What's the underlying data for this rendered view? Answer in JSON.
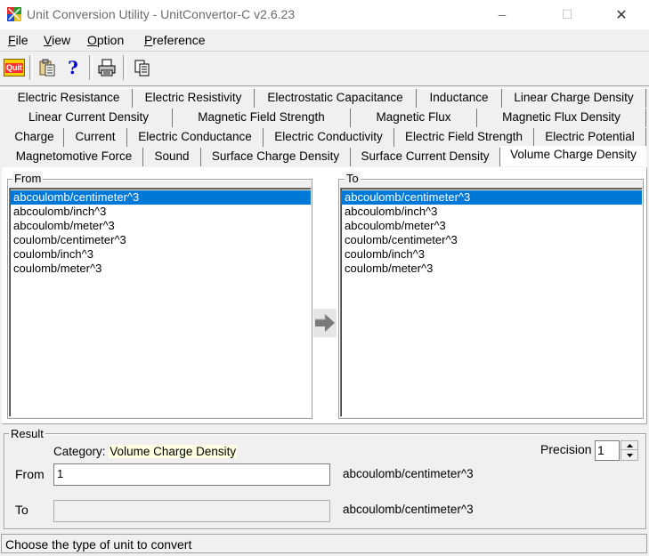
{
  "window": {
    "title": "Unit Conversion Utility - UnitConvertor-C v2.6.23",
    "minimize_glyph": "─",
    "maximize_glyph": "☐",
    "close_glyph": "✕"
  },
  "menu": [
    {
      "label": "File",
      "accel": "F",
      "rest": "ile"
    },
    {
      "label": "View",
      "accel": "V",
      "rest": "iew"
    },
    {
      "label": "Option",
      "accel": "O",
      "rest": "ption"
    },
    {
      "label": "Preference",
      "accel": "P",
      "rest": "reference"
    }
  ],
  "toolbar": {
    "quit_label": "Quit",
    "buttons": [
      "quit-icon",
      "copy-to-clipboard-icon",
      "help-icon",
      "print-icon",
      "paste-icon"
    ]
  },
  "tabs": {
    "row1": [
      "Electric Resistance",
      "Electric Resistivity",
      "Electrostatic Capacitance",
      "Inductance",
      "Linear Charge Density"
    ],
    "row2": [
      "Linear Current Density",
      "Magnetic Field Strength",
      "Magnetic Flux",
      "Magnetic Flux Density"
    ],
    "row3": [
      "Charge",
      "Current",
      "Electric Conductance",
      "Electric Conductivity",
      "Electric Field Strength",
      "Electric Potential"
    ],
    "row4": [
      "Magnetomotive Force",
      "Sound",
      "Surface Charge Density",
      "Surface Current Density",
      "Volume Charge Density"
    ],
    "active": "Volume Charge Density"
  },
  "from_panel": {
    "legend": "From",
    "units": [
      "abcoulomb/centimeter^3",
      "abcoulomb/inch^3",
      "abcoulomb/meter^3",
      "coulomb/centimeter^3",
      "coulomb/inch^3",
      "coulomb/meter^3"
    ],
    "selected_index": 0
  },
  "to_panel": {
    "legend": "To",
    "units": [
      "abcoulomb/centimeter^3",
      "abcoulomb/inch^3",
      "abcoulomb/meter^3",
      "coulomb/centimeter^3",
      "coulomb/inch^3",
      "coulomb/meter^3"
    ],
    "selected_index": 0
  },
  "convert_arrow": "arrow-right-icon",
  "result": {
    "legend": "Result",
    "category_label": "Category:",
    "category_value": "Volume Charge Density",
    "precision_label": "Precision",
    "precision_value": "1",
    "from_label": "From",
    "from_value": "1",
    "from_unit": "abcoulomb/centimeter^3",
    "to_label": "To",
    "to_value": "",
    "to_unit": "abcoulomb/centimeter^3"
  },
  "status": "Choose the type of unit to convert",
  "colors": {
    "selection": "#0078d7",
    "category_highlight": "#ffffe1",
    "window_bg": "#f0f0f0"
  }
}
